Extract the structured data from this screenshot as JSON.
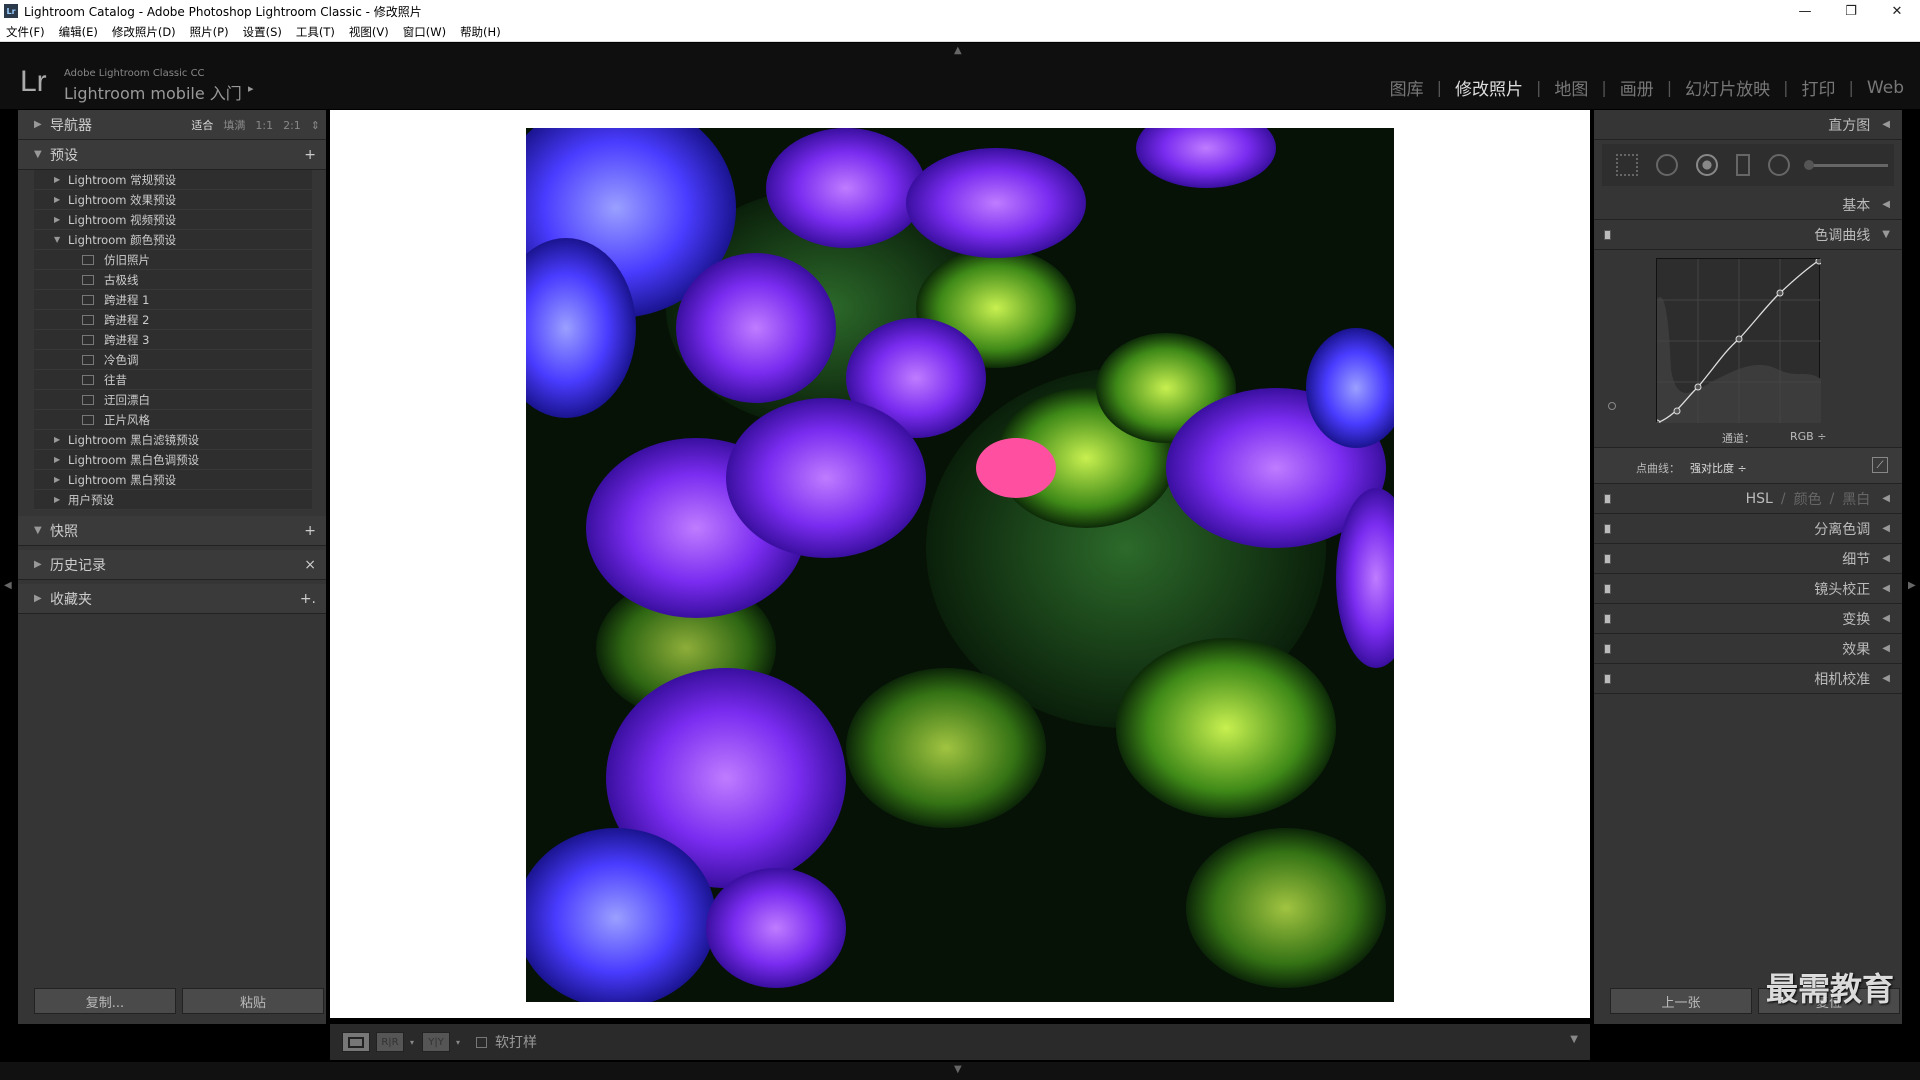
{
  "window": {
    "title": "Lightroom Catalog - Adobe Photoshop Lightroom Classic - 修改照片",
    "icon_text": "Lr",
    "minimize": "—",
    "maximize": "❐",
    "close": "✕"
  },
  "menu": [
    "文件(F)",
    "编辑(E)",
    "修改照片(D)",
    "照片(P)",
    "设置(S)",
    "工具(T)",
    "视图(V)",
    "窗口(W)",
    "帮助(H)"
  ],
  "identity": {
    "logo": "Lr",
    "product": "Adobe Lightroom Classic CC",
    "mobile": "Lightroom mobile 入门",
    "arrow": "▸"
  },
  "modules": [
    "图库",
    "修改照片",
    "地图",
    "画册",
    "幻灯片放映",
    "打印",
    "Web"
  ],
  "left": {
    "navigator": {
      "title": "导航器",
      "zoom": [
        "适合",
        "填满",
        "1:1",
        "2:1"
      ],
      "zoom_more": "⇕"
    },
    "presets": {
      "title": "预设",
      "add": "+",
      "items": [
        {
          "label": "Lightroom 常规预设",
          "type": "folder",
          "expanded": false
        },
        {
          "label": "Lightroom 效果预设",
          "type": "folder",
          "expanded": false
        },
        {
          "label": "Lightroom 视频预设",
          "type": "folder",
          "expanded": false
        },
        {
          "label": "Lightroom 颜色预设",
          "type": "folder",
          "expanded": true
        },
        {
          "label": "仿旧照片",
          "type": "preset"
        },
        {
          "label": "古极线",
          "type": "preset"
        },
        {
          "label": "跨进程 1",
          "type": "preset"
        },
        {
          "label": "跨进程 2",
          "type": "preset"
        },
        {
          "label": "跨进程 3",
          "type": "preset"
        },
        {
          "label": "冷色调",
          "type": "preset"
        },
        {
          "label": "往昔",
          "type": "preset"
        },
        {
          "label": "迂回漂白",
          "type": "preset"
        },
        {
          "label": "正片风格",
          "type": "preset"
        },
        {
          "label": "Lightroom 黑白滤镜预设",
          "type": "folder",
          "expanded": false
        },
        {
          "label": "Lightroom 黑白色调预设",
          "type": "folder",
          "expanded": false
        },
        {
          "label": "Lightroom 黑白预设",
          "type": "folder",
          "expanded": false
        },
        {
          "label": "用户预设",
          "type": "folder",
          "expanded": false
        }
      ]
    },
    "snapshots": {
      "title": "快照",
      "action": "+"
    },
    "history": {
      "title": "历史记录",
      "action": "×"
    },
    "collections": {
      "title": "收藏夹",
      "action": "+."
    },
    "copy_label": "复制...",
    "paste_label": "粘贴"
  },
  "toolbar": {
    "softproof_label": "软打样",
    "dropdown": "▼",
    "caret": "▾",
    "compare_glyph": "R|R",
    "survey_glyph": "Y|Y"
  },
  "right": {
    "histogram": "直方图",
    "basic": "基本",
    "tone_curve": "色调曲线",
    "channel_label": "通道：",
    "channel_value": "RGB ÷",
    "point_curve_label": "点曲线：",
    "point_curve_value": "强对比度 ÷",
    "hsl": [
      "HSL",
      "/",
      "颜色",
      "/",
      "黑白"
    ],
    "panels": [
      "分离色调",
      "细节",
      "镜头校正",
      "变换",
      "效果",
      "相机校准"
    ],
    "prev_label": "上一张",
    "reset_label": "复位",
    "arrow_left": "◀",
    "arrow_down": "▼"
  },
  "watermark": "最需教育",
  "colors": {
    "panel": "#353535",
    "accent": "#dddddd",
    "canvas": "#ffffff"
  },
  "edge_arrows": {
    "left": "◀",
    "right": "▶",
    "top": "▲",
    "bottom": "▼"
  }
}
